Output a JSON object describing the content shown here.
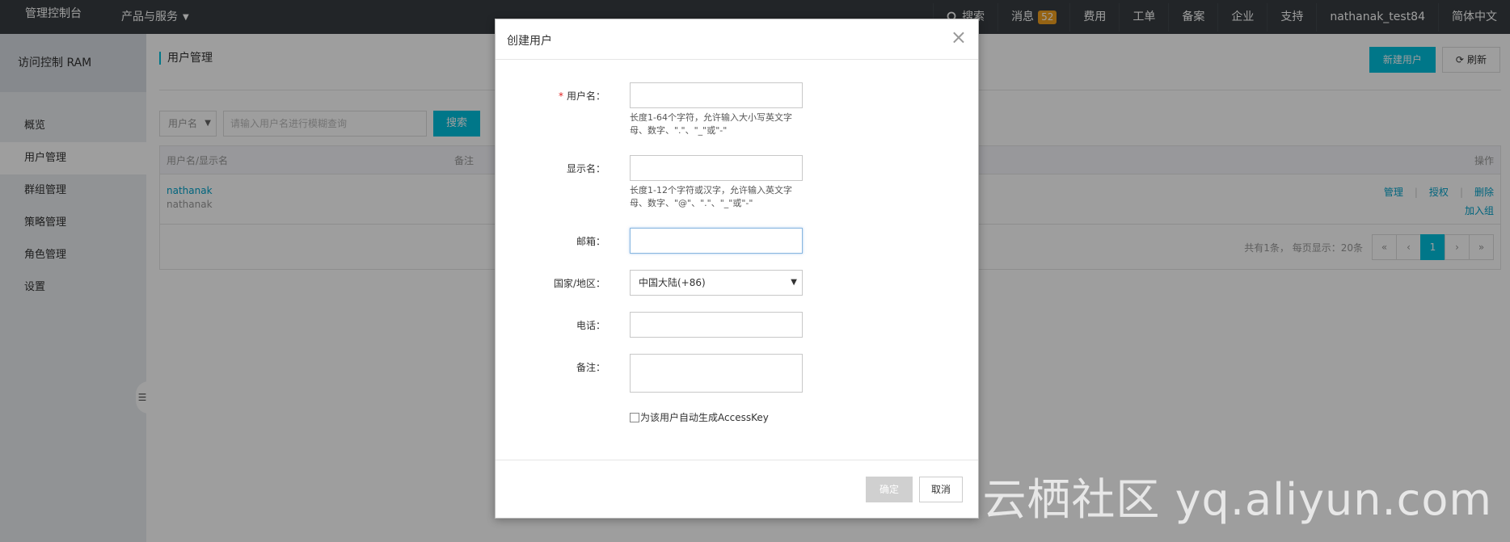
{
  "topbar": {
    "brand": "管理控制台",
    "products": "产品与服务",
    "search": "搜索",
    "messages": "消息",
    "message_count": "52",
    "items": [
      "费用",
      "工单",
      "备案",
      "企业",
      "支持"
    ],
    "user": "nathanak_test84",
    "language": "简体中文"
  },
  "sidebar": {
    "title": "访问控制 RAM",
    "items": [
      {
        "label": "概览"
      },
      {
        "label": "用户管理"
      },
      {
        "label": "群组管理"
      },
      {
        "label": "策略管理"
      },
      {
        "label": "角色管理"
      },
      {
        "label": "设置"
      }
    ],
    "active_index": 1,
    "collapse_icon": "list-icon"
  },
  "main": {
    "breadcrumb": "用户管理",
    "new_user_label": "新建用户",
    "refresh_label": "刷新",
    "search": {
      "filter_selected": "用户名",
      "placeholder": "请输入用户名进行模糊查询",
      "button": "搜索"
    },
    "table": {
      "columns": [
        "用户名/显示名",
        "备注",
        "操作"
      ],
      "rows": [
        {
          "username": "nathanak",
          "display_name": "nathanak",
          "actions": [
            "管理",
            "授权",
            "删除",
            "加入组"
          ]
        }
      ]
    },
    "pagination": {
      "info": "共有1条， 每页显示：20条",
      "first": "«",
      "prev": "‹",
      "current": "1",
      "next": "›",
      "last": "»"
    }
  },
  "modal": {
    "title": "创建用户",
    "fields": {
      "username": {
        "label": "用户名：",
        "required_mark": "*",
        "hint": "长度1-64个字符，允许输入大小写英文字母、数字、\".\"、\"_\"或\"-\""
      },
      "display_name": {
        "label": "显示名：",
        "hint": "长度1-12个字符或汉字，允许输入英文字母、数字、\"@\"、\".\"、\"_\"或\"-\""
      },
      "email": {
        "label": "邮箱："
      },
      "country": {
        "label": "国家/地区：",
        "selected": "中国大陆(+86)"
      },
      "phone": {
        "label": "电话："
      },
      "remark": {
        "label": "备注："
      }
    },
    "auto_accesskey_label": "为该用户自动生成AccessKey",
    "confirm_label": "确定",
    "cancel_label": "取消"
  },
  "watermark": "云栖社区 yq.aliyun.com",
  "colors": {
    "accent": "#00c1de",
    "topbar": "#373d41",
    "badge": "#f0a020"
  }
}
